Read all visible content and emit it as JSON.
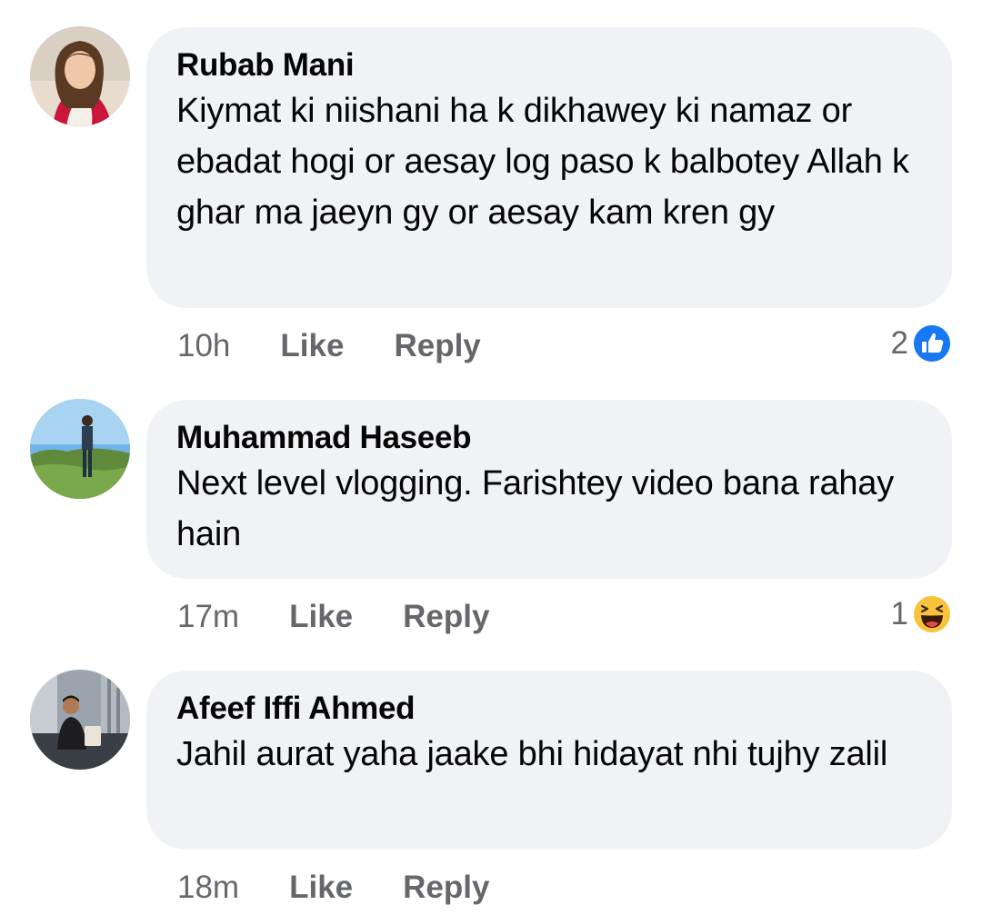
{
  "comments": [
    {
      "author": "Rubab Mani",
      "text": "Kiymat ki niishani ha k dikhawey ki namaz or ebadat hogi or aesay log paso k balbotey Allah k ghar ma jaeyn gy or aesay kam kren gy",
      "time": "10h",
      "like_label": "Like",
      "reply_label": "Reply",
      "reaction_count": "2",
      "reaction_icon": "like-icon"
    },
    {
      "author": "Muhammad Haseeb",
      "text": "Next level vlogging. Farishtey video bana rahay hain",
      "time": "17m",
      "like_label": "Like",
      "reply_label": "Reply",
      "reaction_count": "1",
      "reaction_icon": "haha-icon"
    },
    {
      "author": "Afeef Iffi Ahmed",
      "text": "Jahil aurat yaha jaake bhi hidayat nhi tujhy zalil",
      "time": "18m",
      "like_label": "Like",
      "reply_label": "Reply"
    }
  ],
  "colors": {
    "bubble": "#f0f2f5",
    "secondary_text": "#65676b",
    "like_blue": "#1877f2",
    "haha_yellow": "#f7c33a"
  }
}
